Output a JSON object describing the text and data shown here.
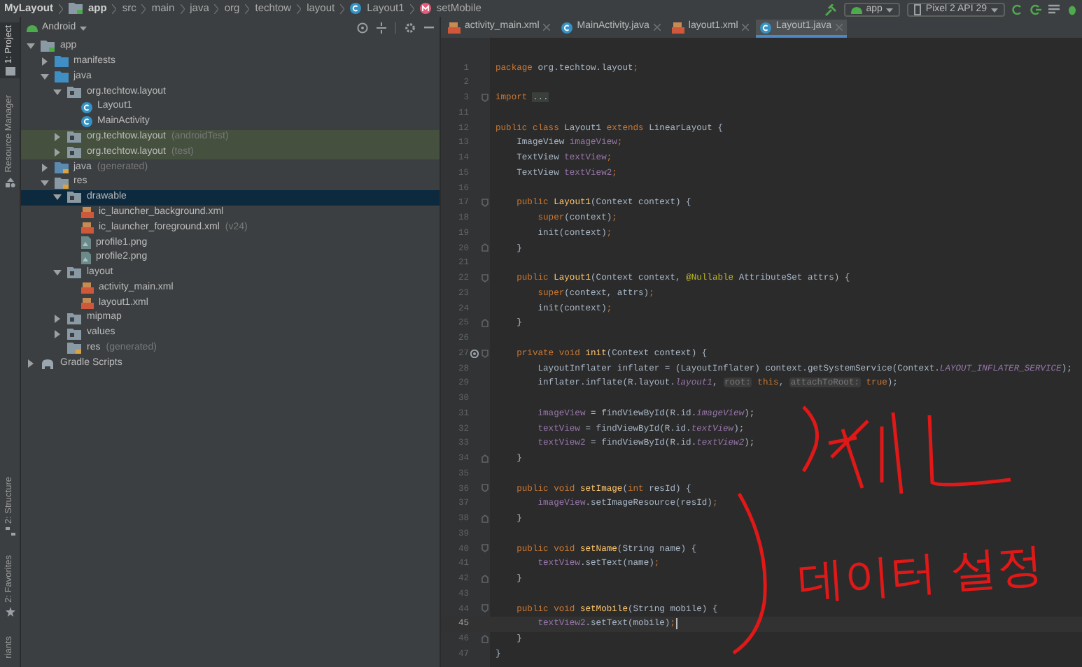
{
  "breadcrumb": [
    {
      "label": "MyLayout",
      "kind": "project"
    },
    {
      "label": "app",
      "kind": "module"
    },
    {
      "label": "src",
      "kind": "dir"
    },
    {
      "label": "main",
      "kind": "dir"
    },
    {
      "label": "java",
      "kind": "dir"
    },
    {
      "label": "org",
      "kind": "dir"
    },
    {
      "label": "techtow",
      "kind": "dir"
    },
    {
      "label": "layout",
      "kind": "dir"
    },
    {
      "label": "Layout1",
      "kind": "class"
    },
    {
      "label": "setMobile",
      "kind": "method"
    }
  ],
  "toolbar": {
    "run_config": "app",
    "device": "Pixel 2 API 29"
  },
  "side_tools": [
    {
      "label": "1: Project",
      "selected": true,
      "kind": "project"
    },
    {
      "label": "Resource Manager",
      "selected": false,
      "kind": "resources"
    },
    {
      "label": "2: Structure",
      "selected": false,
      "kind": "structure"
    },
    {
      "label": "2: Favorites",
      "selected": false,
      "kind": "favorites"
    },
    {
      "label": "riants",
      "selected": false,
      "kind": "variants"
    }
  ],
  "project_panel": {
    "view": "Android",
    "tree": [
      {
        "label": "app",
        "kind": "module",
        "expanded": true,
        "selected": false,
        "highlighted": false,
        "children": [
          {
            "label": "manifests",
            "kind": "folder",
            "expanded": false,
            "selected": false,
            "highlighted": false
          },
          {
            "label": "java",
            "kind": "folder",
            "expanded": true,
            "selected": false,
            "highlighted": false,
            "children": [
              {
                "label": "org.techtow.layout",
                "kind": "package",
                "expanded": true,
                "selected": false,
                "highlighted": false,
                "children": [
                  {
                    "label": "Layout1",
                    "kind": "class",
                    "selected": false,
                    "highlighted": false
                  },
                  {
                    "label": "MainActivity",
                    "kind": "class",
                    "selected": false,
                    "highlighted": false
                  }
                ]
              },
              {
                "label": "org.techtow.layout",
                "suffix": "(androidTest)",
                "kind": "package",
                "expanded": false,
                "selected": false,
                "highlighted": true
              },
              {
                "label": "org.techtow.layout",
                "suffix": "(test)",
                "kind": "package",
                "expanded": false,
                "selected": false,
                "highlighted": true
              }
            ]
          },
          {
            "label": "java",
            "suffix": "(generated)",
            "kind": "generated",
            "expanded": false,
            "selected": false,
            "highlighted": false
          },
          {
            "label": "res",
            "kind": "resfolder",
            "expanded": true,
            "selected": false,
            "highlighted": false,
            "children": [
              {
                "label": "drawable",
                "kind": "package",
                "expanded": true,
                "selected": true,
                "highlighted": false,
                "children": [
                  {
                    "label": "ic_launcher_background.xml",
                    "kind": "xml",
                    "selected": false,
                    "highlighted": false
                  },
                  {
                    "label": "ic_launcher_foreground.xml",
                    "suffix": "(v24)",
                    "kind": "xml",
                    "selected": false,
                    "highlighted": false
                  },
                  {
                    "label": "profile1.png",
                    "kind": "image",
                    "selected": false,
                    "highlighted": false
                  },
                  {
                    "label": "profile2.png",
                    "kind": "image",
                    "selected": false,
                    "highlighted": false
                  }
                ]
              },
              {
                "label": "layout",
                "kind": "package",
                "expanded": true,
                "selected": false,
                "highlighted": false,
                "children": [
                  {
                    "label": "activity_main.xml",
                    "kind": "xml",
                    "selected": false,
                    "highlighted": false
                  },
                  {
                    "label": "layout1.xml",
                    "kind": "xml",
                    "selected": false,
                    "highlighted": false
                  }
                ]
              },
              {
                "label": "mipmap",
                "kind": "package",
                "expanded": false,
                "selected": false,
                "highlighted": false
              },
              {
                "label": "values",
                "kind": "package",
                "expanded": false,
                "selected": false,
                "highlighted": false
              },
              {
                "label": "res",
                "suffix": "(generated)",
                "kind": "resfolder",
                "selected": false,
                "highlighted": false
              }
            ]
          }
        ]
      },
      {
        "label": "Gradle Scripts",
        "kind": "gradle",
        "expanded": false,
        "selected": false,
        "highlighted": false
      }
    ]
  },
  "tabs": [
    {
      "label": "activity_main.xml",
      "kind": "xml",
      "selected": false
    },
    {
      "label": "MainActivity.java",
      "kind": "class",
      "selected": false
    },
    {
      "label": "layout1.xml",
      "kind": "xml",
      "selected": false
    },
    {
      "label": "Layout1.java",
      "kind": "class",
      "selected": true
    }
  ],
  "code_lines": [
    {
      "number": "1",
      "segments": [
        {
          "text": "package",
          "kind": "keyword"
        },
        {
          "text": " org.techtow.layout",
          "kind": "plain"
        },
        {
          "text": ";",
          "kind": "keyword"
        }
      ]
    },
    {
      "number": "2"
    },
    {
      "number": "3",
      "fold_start": true,
      "segments": [
        {
          "text": "import ",
          "kind": "keyword"
        },
        {
          "text": "...",
          "kind": "folded"
        }
      ]
    },
    {
      "number": "11"
    },
    {
      "number": "12",
      "segments": [
        {
          "text": "public class",
          "kind": "keyword"
        },
        {
          "text": " Layout1 ",
          "kind": "plain"
        },
        {
          "text": "extends",
          "kind": "keyword"
        },
        {
          "text": " LinearLayout {",
          "kind": "plain"
        }
      ]
    },
    {
      "number": "13",
      "segments": [
        {
          "text": "    ImageView ",
          "kind": "plain"
        },
        {
          "text": "imageView",
          "kind": "field"
        },
        {
          "text": ";",
          "kind": "keyword"
        }
      ]
    },
    {
      "number": "14",
      "segments": [
        {
          "text": "    TextView ",
          "kind": "plain"
        },
        {
          "text": "textView",
          "kind": "field"
        },
        {
          "text": ";",
          "kind": "keyword"
        }
      ]
    },
    {
      "number": "15",
      "segments": [
        {
          "text": "    TextView ",
          "kind": "plain"
        },
        {
          "text": "textView2",
          "kind": "field"
        },
        {
          "text": ";",
          "kind": "keyword"
        }
      ]
    },
    {
      "number": "16"
    },
    {
      "number": "17",
      "fold_start": true,
      "segments": [
        {
          "text": "    public ",
          "kind": "keyword"
        },
        {
          "text": "Layout1",
          "kind": "method"
        },
        {
          "text": "(Context context) {",
          "kind": "plain"
        }
      ]
    },
    {
      "number": "18",
      "segments": [
        {
          "text": "        super",
          "kind": "keyword"
        },
        {
          "text": "(context)",
          "kind": "plain"
        },
        {
          "text": ";",
          "kind": "keyword"
        }
      ]
    },
    {
      "number": "19",
      "segments": [
        {
          "text": "        init(context)",
          "kind": "plain"
        },
        {
          "text": ";",
          "kind": "keyword"
        }
      ]
    },
    {
      "number": "20",
      "fold_end": true,
      "segments": [
        {
          "text": "    }",
          "kind": "plain"
        }
      ]
    },
    {
      "number": "21"
    },
    {
      "number": "22",
      "fold_start": true,
      "segments": [
        {
          "text": "    public ",
          "kind": "keyword"
        },
        {
          "text": "Layout1",
          "kind": "method"
        },
        {
          "text": "(Context context, ",
          "kind": "plain"
        },
        {
          "text": "@Nullable",
          "kind": "annotation"
        },
        {
          "text": " AttributeSet attrs) {",
          "kind": "plain"
        }
      ]
    },
    {
      "number": "23",
      "segments": [
        {
          "text": "        super",
          "kind": "keyword"
        },
        {
          "text": "(context, attrs)",
          "kind": "plain"
        },
        {
          "text": ";",
          "kind": "keyword"
        }
      ]
    },
    {
      "number": "24",
      "segments": [
        {
          "text": "        init(context)",
          "kind": "plain"
        },
        {
          "text": ";",
          "kind": "keyword"
        }
      ]
    },
    {
      "number": "25",
      "fold_end": true,
      "segments": [
        {
          "text": "    }",
          "kind": "plain"
        }
      ]
    },
    {
      "number": "26"
    },
    {
      "number": "27",
      "fold_start": true,
      "marker": true,
      "segments": [
        {
          "text": "    private void ",
          "kind": "keyword"
        },
        {
          "text": "init",
          "kind": "method"
        },
        {
          "text": "(Context context) {",
          "kind": "plain"
        }
      ]
    },
    {
      "number": "28",
      "segments": [
        {
          "text": "        LayoutInflater inflater = (LayoutInflater) context.getSystemService(Context.",
          "kind": "plain"
        },
        {
          "text": "LAYOUT_INFLATER_SERVICE",
          "kind": "constant"
        },
        {
          "text": ");",
          "kind": "plain"
        }
      ]
    },
    {
      "number": "29",
      "segments": [
        {
          "text": "        inflater.inflate(R.layout.",
          "kind": "plain"
        },
        {
          "text": "layout1",
          "kind": "constant"
        },
        {
          "text": ", ",
          "kind": "plain"
        },
        {
          "text": "root:",
          "kind": "hint"
        },
        {
          "text": " this",
          "kind": "keyword"
        },
        {
          "text": ", ",
          "kind": "plain"
        },
        {
          "text": "attachToRoot:",
          "kind": "hint"
        },
        {
          "text": " true",
          "kind": "keyword"
        },
        {
          "text": ");",
          "kind": "plain"
        }
      ]
    },
    {
      "number": "30"
    },
    {
      "number": "31",
      "segments": [
        {
          "text": "        imageView",
          "kind": "field"
        },
        {
          "text": " = findViewById(R.id.",
          "kind": "plain"
        },
        {
          "text": "imageView",
          "kind": "constant"
        },
        {
          "text": ");",
          "kind": "plain"
        }
      ]
    },
    {
      "number": "32",
      "segments": [
        {
          "text": "        textView",
          "kind": "field"
        },
        {
          "text": " = findViewById(R.id.",
          "kind": "plain"
        },
        {
          "text": "textView",
          "kind": "constant"
        },
        {
          "text": ");",
          "kind": "plain"
        }
      ]
    },
    {
      "number": "33",
      "segments": [
        {
          "text": "        textView2",
          "kind": "field"
        },
        {
          "text": " = findViewById(R.id.",
          "kind": "plain"
        },
        {
          "text": "textView2",
          "kind": "constant"
        },
        {
          "text": ");",
          "kind": "plain"
        }
      ]
    },
    {
      "number": "34",
      "fold_end": true,
      "segments": [
        {
          "text": "    }",
          "kind": "plain"
        }
      ]
    },
    {
      "number": "35"
    },
    {
      "number": "36",
      "fold_start": true,
      "segments": [
        {
          "text": "    public void ",
          "kind": "keyword"
        },
        {
          "text": "setImage",
          "kind": "method"
        },
        {
          "text": "(",
          "kind": "plain"
        },
        {
          "text": "int",
          "kind": "keyword"
        },
        {
          "text": " resId) {",
          "kind": "plain"
        }
      ]
    },
    {
      "number": "37",
      "segments": [
        {
          "text": "        imageView",
          "kind": "field"
        },
        {
          "text": ".setImageResource(resId)",
          "kind": "plain"
        },
        {
          "text": ";",
          "kind": "keyword"
        }
      ]
    },
    {
      "number": "38",
      "fold_end": true,
      "segments": [
        {
          "text": "    }",
          "kind": "plain"
        }
      ]
    },
    {
      "number": "39"
    },
    {
      "number": "40",
      "fold_start": true,
      "segments": [
        {
          "text": "    public void ",
          "kind": "keyword"
        },
        {
          "text": "setName",
          "kind": "method"
        },
        {
          "text": "(String name) {",
          "kind": "plain"
        }
      ]
    },
    {
      "number": "41",
      "segments": [
        {
          "text": "        textView",
          "kind": "field"
        },
        {
          "text": ".setText(name)",
          "kind": "plain"
        },
        {
          "text": ";",
          "kind": "keyword"
        }
      ]
    },
    {
      "number": "42",
      "fold_end": true,
      "segments": [
        {
          "text": "    }",
          "kind": "plain"
        }
      ]
    },
    {
      "number": "43"
    },
    {
      "number": "44",
      "fold_start": true,
      "segments": [
        {
          "text": "    public void ",
          "kind": "keyword"
        },
        {
          "text": "setMobile",
          "kind": "method"
        },
        {
          "text": "(String mobile) {",
          "kind": "plain"
        }
      ]
    },
    {
      "number": "45",
      "current": true,
      "segments": [
        {
          "text": "        textView2",
          "kind": "field"
        },
        {
          "text": ".setText(mobile)",
          "kind": "plain"
        },
        {
          "text": ";",
          "kind": "keyword"
        }
      ]
    },
    {
      "number": "46",
      "fold_end": true,
      "segments": [
        {
          "text": "    }",
          "kind": "plain"
        }
      ]
    },
    {
      "number": "47",
      "segments": [
        {
          "text": "}",
          "kind": "plain"
        }
      ]
    }
  ],
  "annotations": [
    {
      "kind": "bracket-scribble"
    },
    {
      "kind": "bracket-text",
      "text": "데이터 설정"
    }
  ]
}
